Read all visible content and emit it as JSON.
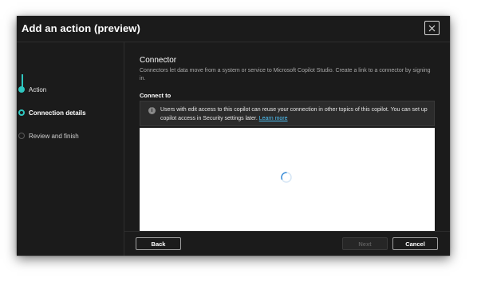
{
  "dialog": {
    "title": "Add an action (preview)"
  },
  "steps": [
    {
      "label": "Action",
      "state": "done"
    },
    {
      "label": "Connection details",
      "state": "current"
    },
    {
      "label": "Review and finish",
      "state": "pending"
    }
  ],
  "main": {
    "section_title": "Connector",
    "section_desc": "Connectors let data move from a system or service to Microsoft Copilot Studio. Create a link to a connector by signing in.",
    "connect_label": "Connect to",
    "info_text": "Users with edit access to this copilot can reuse your connection in other topics of this copilot. You can set up copilot access in Security settings later.",
    "info_link": "Learn more"
  },
  "footer": {
    "back_label": "Back",
    "next_label": "Next",
    "cancel_label": "Cancel"
  },
  "colors": {
    "accent": "#2fc7c0",
    "link": "#4fc3f7",
    "dialog_bg": "#1b1b1b"
  }
}
